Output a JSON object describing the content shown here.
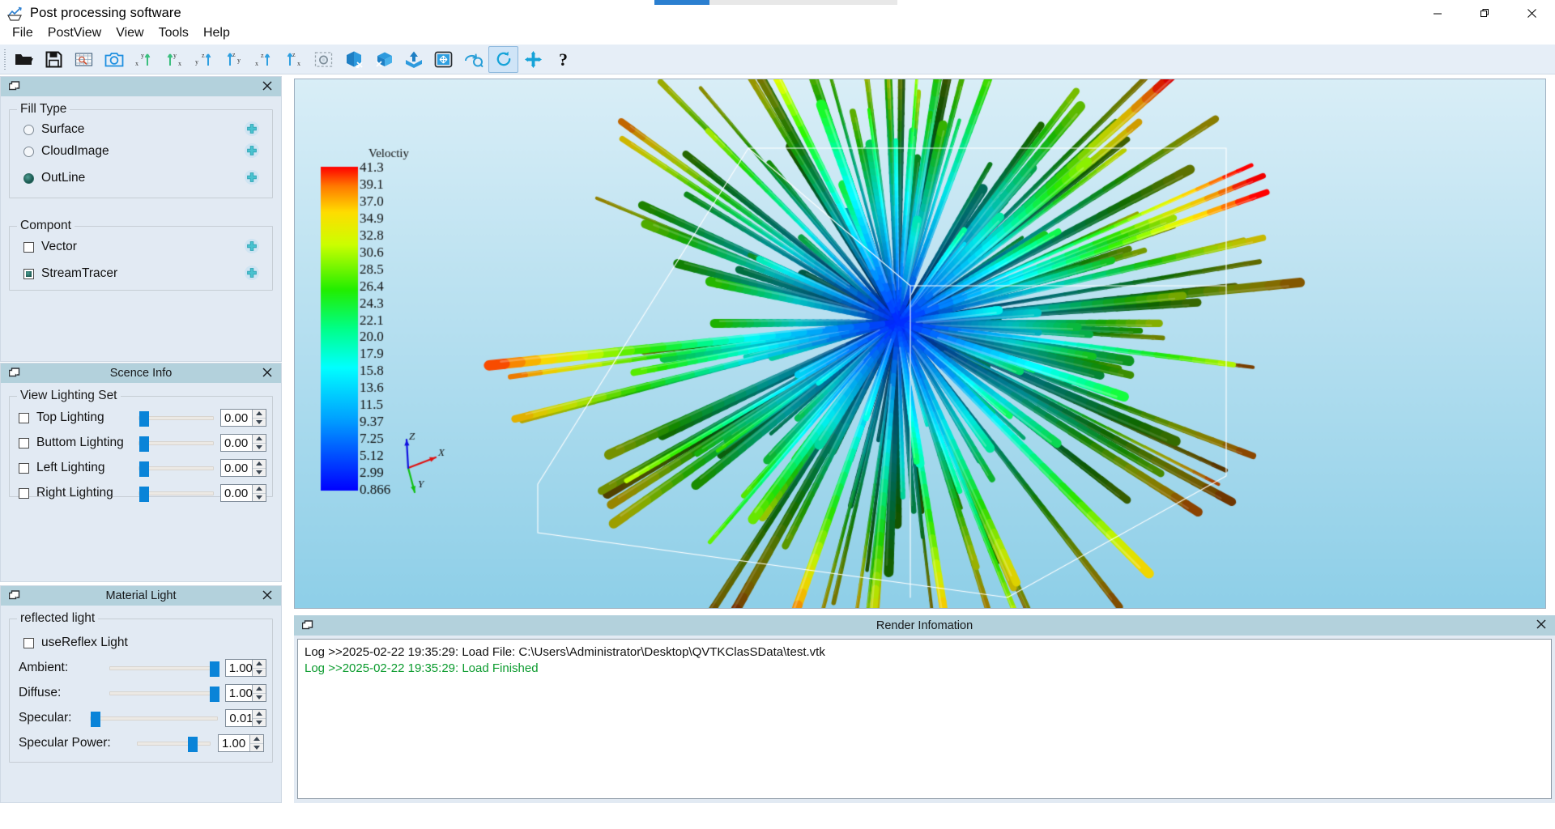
{
  "window": {
    "title": "Post processing software",
    "app_icon": "chart-line-icon",
    "minimize_label": "—",
    "maximize_label": "❐",
    "close_label": "✕"
  },
  "menubar": {
    "items": [
      {
        "label": "File",
        "name": "menu-file"
      },
      {
        "label": "PostView",
        "name": "menu-postview"
      },
      {
        "label": "View",
        "name": "menu-view"
      },
      {
        "label": "Tools",
        "name": "menu-tools"
      },
      {
        "label": "Help",
        "name": "menu-help"
      }
    ]
  },
  "toolbar": {
    "buttons": [
      {
        "name": "open-file-button",
        "icon": "folder-open-icon",
        "tooltip": "Open"
      },
      {
        "name": "save-file-button",
        "icon": "floppy-disk-icon",
        "tooltip": "Save"
      },
      {
        "name": "mesh-view-button",
        "icon": "wireframe-box-icon",
        "tooltip": "Mesh"
      },
      {
        "name": "screenshot-button",
        "icon": "camera-icon",
        "tooltip": "Screenshot"
      },
      {
        "name": "view-xy-negative-button",
        "icon": "axis-xy-icon",
        "tooltip": "View -X +Y"
      },
      {
        "name": "view-yx-button",
        "icon": "axis-yx-icon",
        "tooltip": "View +Y"
      },
      {
        "name": "view-yz-button",
        "icon": "axis-yz-icon",
        "tooltip": "View Y Z"
      },
      {
        "name": "view-zy-button",
        "icon": "axis-zy-icon",
        "tooltip": "View Z Y"
      },
      {
        "name": "view-xz-button",
        "icon": "axis-xz-icon",
        "tooltip": "View X Z"
      },
      {
        "name": "view-zx-button",
        "icon": "axis-zx-icon",
        "tooltip": "View Z X"
      },
      {
        "name": "region-capture-button",
        "icon": "dashed-camera-icon",
        "tooltip": "Region capture"
      },
      {
        "name": "clip-cut-button",
        "icon": "cube-cut-icon",
        "tooltip": "Clip"
      },
      {
        "name": "slice-cut-button",
        "icon": "cube-slice-icon",
        "tooltip": "Slice"
      },
      {
        "name": "export-button",
        "icon": "export-up-icon",
        "tooltip": "Export"
      },
      {
        "name": "fit-view-button",
        "icon": "fit-screen-icon",
        "tooltip": "Fit to screen"
      },
      {
        "name": "reset-camera-button",
        "icon": "rotate-reset-icon",
        "tooltip": "Reset camera"
      },
      {
        "name": "refresh-button",
        "icon": "refresh-circle-icon",
        "tooltip": "Refresh",
        "selected": true
      },
      {
        "name": "pan-move-button",
        "icon": "move-arrows-icon",
        "tooltip": "Move"
      },
      {
        "name": "help-button",
        "icon": "question-mark-icon",
        "tooltip": "Help"
      }
    ]
  },
  "panels": {
    "properties": {
      "title": "",
      "close_label": "✕",
      "fill_type": {
        "group_title": "Fill Type",
        "options": [
          {
            "label": "Surface",
            "checked": false,
            "add_icon": "plus-circle-icon"
          },
          {
            "label": "CloudImage",
            "checked": false,
            "add_icon": "plus-circle-icon"
          },
          {
            "label": "OutLine",
            "checked": true,
            "add_icon": "plus-circle-icon"
          }
        ]
      },
      "compont": {
        "group_title": "Compont",
        "options": [
          {
            "label": "Vector",
            "checked": false,
            "add_icon": "plus-circle-icon"
          },
          {
            "label": "StreamTracer",
            "checked": true,
            "add_icon": "plus-circle-icon"
          }
        ]
      }
    },
    "scence_info": {
      "title": "Scence Info",
      "close_label": "✕",
      "group_title": "View Lighting Set",
      "rows": [
        {
          "label": "Top Lighting",
          "checked": false,
          "value": "0.00",
          "slider_pct": 0
        },
        {
          "label": "Buttom Lighting",
          "checked": false,
          "value": "0.00",
          "slider_pct": 0
        },
        {
          "label": "Left Lighting",
          "checked": false,
          "value": "0.00",
          "slider_pct": 0
        },
        {
          "label": "Right Lighting",
          "checked": false,
          "value": "0.00",
          "slider_pct": 0
        }
      ]
    },
    "material_light": {
      "title": "Material Light",
      "close_label": "✕",
      "group_title": "reflected light",
      "checkbox": {
        "label": "useReflex Light",
        "checked": false
      },
      "rows": [
        {
          "label": "Ambient:",
          "value": "1.00",
          "slider_pct": 100
        },
        {
          "label": "Diffuse:",
          "value": "1.00",
          "slider_pct": 100
        },
        {
          "label": "Specular:",
          "value": "0.01",
          "slider_pct": 1
        },
        {
          "label": "Specular Power:",
          "value": "1.00",
          "slider_pct": 72
        }
      ]
    },
    "render_information": {
      "title": "Render Infomation",
      "close_label": "✕",
      "log_lines": [
        {
          "text": "Log >>2025-02-22 19:35:29: Load File: C:\\Users\\Administrator\\Desktop\\QVTKClasSData\\test.vtk",
          "type": "info"
        },
        {
          "text": "Log >>2025-02-22 19:35:29: Load Finished",
          "type": "ok"
        }
      ]
    }
  },
  "viewport": {
    "background_top": "#d9eef7",
    "background_bottom": "#8ecfe8",
    "axes_widget": {
      "x_label": "X",
      "y_label": "Y",
      "z_label": "Z",
      "x_color": "#e01010",
      "y_color": "#10c010",
      "z_color": "#1010e0"
    },
    "outline_color": "#ffffff"
  },
  "chart_data": {
    "type": "heatmap",
    "title": "Veloctiy",
    "colorbar_label": "Veloctiy",
    "colormap": "jet",
    "range": [
      0.866,
      41.3
    ],
    "tick_labels": [
      "41.3",
      "39.1",
      "37.0",
      "34.9",
      "32.8",
      "30.6",
      "28.5",
      "26.4",
      "24.3",
      "22.1",
      "20.0",
      "17.9",
      "15.8",
      "13.6",
      "11.5",
      "9.37",
      "7.25",
      "5.12",
      "2.99",
      "0.866"
    ],
    "tick_values": [
      41.3,
      39.1,
      37.0,
      34.9,
      32.8,
      30.6,
      28.5,
      26.4,
      24.3,
      22.1,
      20.0,
      17.9,
      15.8,
      13.6,
      11.5,
      9.37,
      7.25,
      5.12,
      2.99,
      0.866
    ],
    "legend_position": "left",
    "gradient_stops": [
      {
        "pos": 0.0,
        "color": "#0000ff"
      },
      {
        "pos": 0.22,
        "color": "#00a0ff"
      },
      {
        "pos": 0.38,
        "color": "#00ffff"
      },
      {
        "pos": 0.5,
        "color": "#00ff88"
      },
      {
        "pos": 0.62,
        "color": "#22ee00"
      },
      {
        "pos": 0.76,
        "color": "#ccff00"
      },
      {
        "pos": 0.86,
        "color": "#ffdd00"
      },
      {
        "pos": 0.94,
        "color": "#ff7a00"
      },
      {
        "pos": 1.0,
        "color": "#ff0000"
      }
    ],
    "xlabel": "",
    "ylabel": "Veloctiy"
  }
}
